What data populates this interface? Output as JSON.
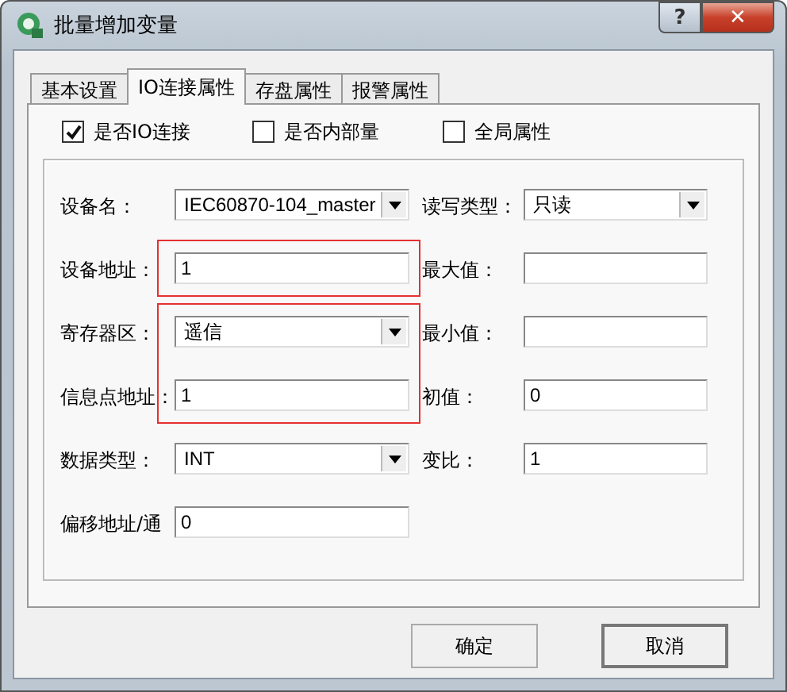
{
  "window": {
    "title": "批量增加变量",
    "help_button": "?",
    "close_button": "✕"
  },
  "tabs": [
    {
      "label": "基本设置",
      "selected": false
    },
    {
      "label": "IO连接属性",
      "selected": true
    },
    {
      "label": "存盘属性",
      "selected": false
    },
    {
      "label": "报警属性",
      "selected": false
    }
  ],
  "options": [
    {
      "label": "是否IO连接",
      "checked": true
    },
    {
      "label": "是否内部量",
      "checked": false
    },
    {
      "label": "全局属性",
      "checked": false
    }
  ],
  "rows": [
    {
      "left": {
        "label": "设备名：",
        "kind": "dropdown",
        "value": "IEC60870-104_master",
        "outlined": false
      },
      "right": {
        "label": "读写类型：",
        "kind": "dropdown",
        "value": "只读"
      }
    },
    {
      "left": {
        "label": "设备地址：",
        "kind": "text",
        "value": "1",
        "outlined": true,
        "outline_continues": false
      },
      "right": {
        "label": "最大值：",
        "kind": "text"
      }
    },
    {
      "left": {
        "label": "寄存器区：",
        "kind": "dropdown",
        "value": "遥信",
        "outlined": true,
        "outline_continues": true
      },
      "right": {
        "label": "最小值：",
        "kind": "text"
      }
    },
    {
      "left": {
        "label": "信息点地址：",
        "kind": "text",
        "value": "1",
        "outlined": true,
        "outline_continues": false
      },
      "right": {
        "label": "初值：",
        "kind": "text",
        "value": "0"
      }
    },
    {
      "left": {
        "label": "数据类型：",
        "kind": "dropdown",
        "value": "INT",
        "outlined": false
      },
      "right": {
        "label": "变比：",
        "kind": "text",
        "value": "1"
      }
    },
    {
      "left": {
        "label": "偏移地址/通",
        "kind": "text",
        "value": "0",
        "outlined": false
      }
    }
  ],
  "buttons": [
    {
      "label": "确定",
      "default": false
    },
    {
      "label": "取消",
      "default": true
    }
  ]
}
